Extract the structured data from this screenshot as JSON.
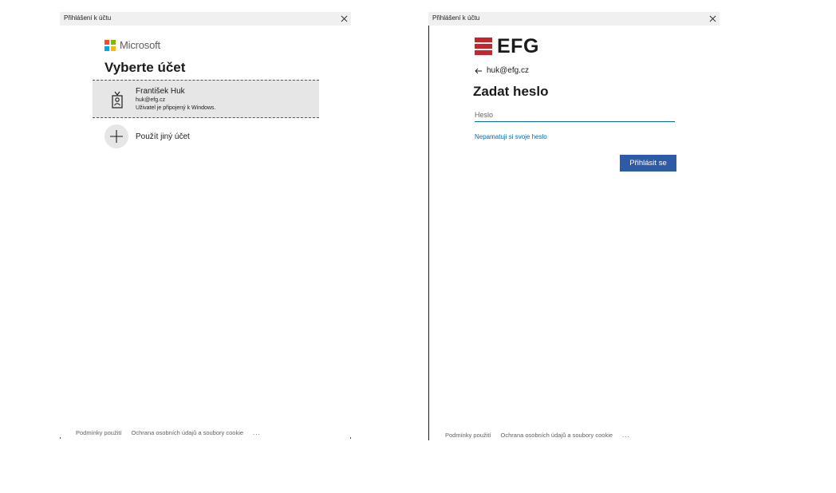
{
  "left_dialog": {
    "title": "Přihlášení k účtu",
    "brand": "Microsoft",
    "brand_colors": [
      "#f25022",
      "#7fba00",
      "#00a4ef",
      "#ffb900"
    ],
    "heading": "Vyberte účet",
    "account": {
      "name": "František Huk",
      "email": "huk@efg.cz",
      "status": "Uživatel je připojený k Windows.",
      "icon": "badge-icon"
    },
    "other_account_label": "Použít jiný účet",
    "footer": {
      "terms": "Podmínky použití",
      "privacy": "Ochrana osobních údajů a soubory cookie",
      "more": "..."
    }
  },
  "right_dialog": {
    "title": "Přihlášení k účtu",
    "brand": "EFG",
    "brand_color": "#c4262e",
    "back_email": "huk@efg.cz",
    "heading": "Zadat heslo",
    "password_placeholder": "Heslo",
    "password_value": "",
    "forgot_link": "Nepamatuji si svoje heslo",
    "signin_button": "Přihlásit se",
    "footer": {
      "terms": "Podmínky použití",
      "privacy": "Ochrana osobních údajů a soubory cookie",
      "more": "..."
    }
  },
  "colors": {
    "accent": "#0067b8",
    "button": "#2d5ba6",
    "tile": "#e6e6e6",
    "titlebar": "#f0f0f0"
  }
}
